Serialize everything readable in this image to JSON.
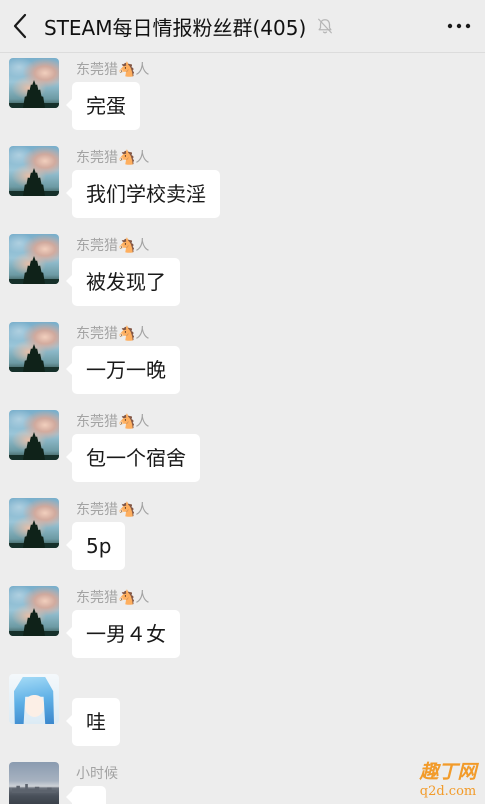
{
  "header": {
    "title": "STEAM每日情报粉丝群(405)",
    "back_icon": "chevron-left-icon",
    "muted_icon": "bell-muted-icon",
    "more_icon": "more-dots-icon"
  },
  "colors": {
    "background": "#ededed",
    "bubble": "#ffffff",
    "sender_name": "#a3a3a3",
    "message_text": "#191919",
    "watermark": "#f29b2a"
  },
  "messages": [
    {
      "sender": "东莞猎🐴人",
      "avatar": "sky-avatar",
      "text": "完蛋"
    },
    {
      "sender": "东莞猎🐴人",
      "avatar": "sky-avatar",
      "text": "我们学校卖淫"
    },
    {
      "sender": "东莞猎🐴人",
      "avatar": "sky-avatar",
      "text": "被发现了"
    },
    {
      "sender": "东莞猎🐴人",
      "avatar": "sky-avatar",
      "text": "一万一晚"
    },
    {
      "sender": "东莞猎🐴人",
      "avatar": "sky-avatar",
      "text": "包一个宿舍"
    },
    {
      "sender": "东莞猎🐴人",
      "avatar": "sky-avatar",
      "text": "5p"
    },
    {
      "sender": "东莞猎🐴人",
      "avatar": "sky-avatar",
      "text": "一男４女"
    },
    {
      "avatar": "anime-avatar",
      "text": "哇"
    },
    {
      "sender": "小时候",
      "avatar": "harbor-avatar"
    }
  ],
  "watermark": {
    "name": "趣丁网",
    "domain": "q2d.com"
  }
}
